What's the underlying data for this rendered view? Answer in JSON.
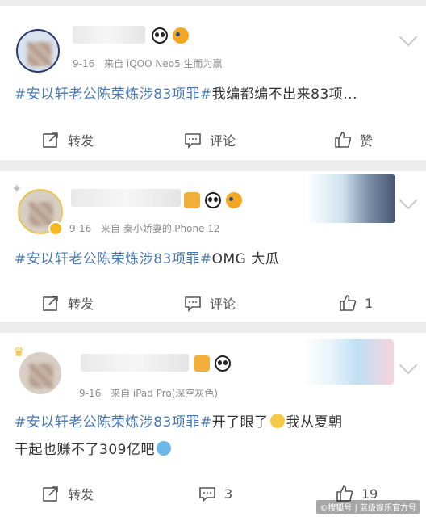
{
  "posts": [
    {
      "meta_date": "9-16",
      "meta_source": "来自 iQOO Neo5 生而为赢",
      "content_topic": "#安以轩老公陈荣炼涉83项罪#",
      "content_text": "我编都编不出来83项...",
      "actions": {
        "repost": "转发",
        "comment": "评论",
        "like": "赞"
      }
    },
    {
      "meta_date": "9-16",
      "meta_source": "来自 秦小娇妻的iPhone 12",
      "content_topic": "#安以轩老公陈荣炼涉83项罪#",
      "content_text": "OMG 大瓜",
      "actions": {
        "repost": "转发",
        "comment": "评论",
        "like": "1"
      }
    },
    {
      "meta_date": "9-16",
      "meta_source": "来自 iPad Pro(深空灰色)",
      "content_topic": "#安以轩老公陈荣炼涉83项罪#",
      "content_text_line1": "开了眼了",
      "content_text_line1b": "我从夏朝",
      "content_text_line2": "干起也赚不了309亿吧",
      "actions": {
        "repost": "转发",
        "comment": "3",
        "like": "19"
      }
    }
  ],
  "watermark": "©搜狐号 | 蓝级娱乐官方号",
  "colors": {
    "topic": "#4a7ab4",
    "background": "#ececec",
    "card": "#ffffff"
  }
}
